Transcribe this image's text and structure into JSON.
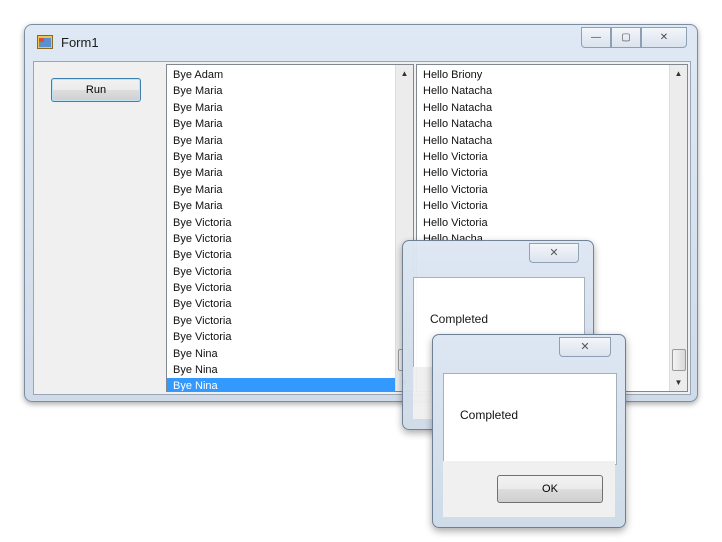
{
  "window": {
    "title": "Form1",
    "minimize_glyph": "—",
    "maximize_glyph": "▢",
    "close_glyph": "✕"
  },
  "run_button": {
    "label": "Run"
  },
  "left_list": {
    "items": [
      "Bye Adam",
      "Bye Maria",
      "Bye Maria",
      "Bye Maria",
      "Bye Maria",
      "Bye Maria",
      "Bye Maria",
      "Bye Maria",
      "Bye Maria",
      "Bye Victoria",
      "Bye Victoria",
      "Bye Victoria",
      "Bye Victoria",
      "Bye Victoria",
      "Bye Victoria",
      "Bye Victoria",
      "Bye Victoria",
      "Bye Nina",
      "Bye Nina",
      "Bye Nina"
    ],
    "selected_index": 19
  },
  "right_list": {
    "items": [
      "Hello Briony",
      "Hello Natacha",
      "Hello Natacha",
      "Hello Natacha",
      "Hello Natacha",
      "Hello Victoria",
      "Hello Victoria",
      "Hello Victoria",
      "Hello Victoria",
      "Hello Victoria",
      "Hello Nacha"
    ],
    "selected_index": -1
  },
  "scroll_glyphs": {
    "up": "▲",
    "down": "▼"
  },
  "dialog_back": {
    "message": "Completed",
    "close_glyph": "✕"
  },
  "dialog_front": {
    "message": "Completed",
    "close_glyph": "✕",
    "ok_label": "OK"
  },
  "colors": {
    "selection": "#3399ff",
    "window_frame": "#cfdbe9",
    "button_border": "#3c7fb1"
  }
}
